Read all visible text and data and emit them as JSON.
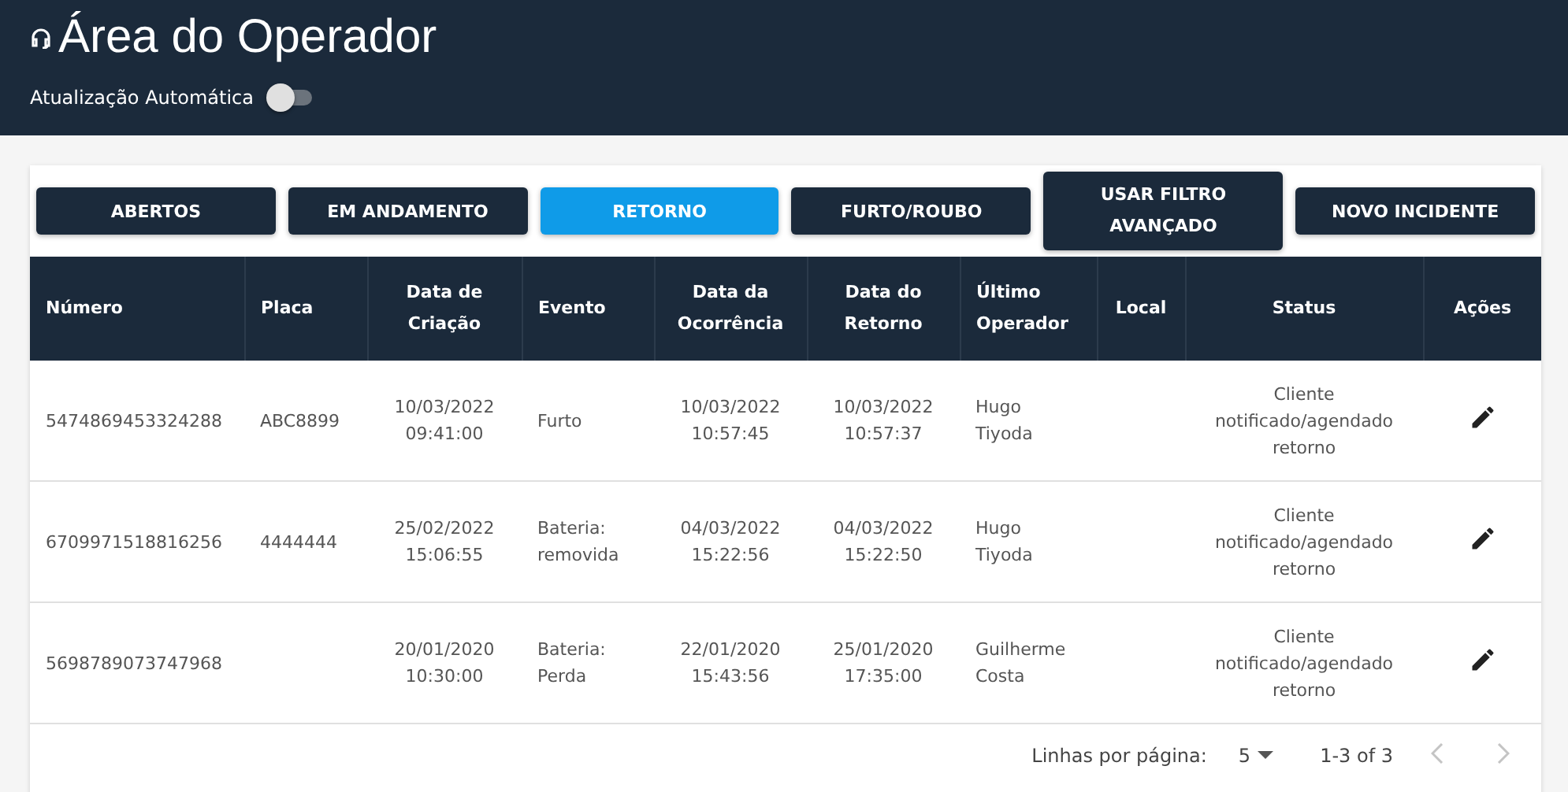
{
  "header": {
    "title": "Área do Operador",
    "auto_refresh": {
      "label": "Atualização Automática",
      "on": false
    }
  },
  "tabs": [
    {
      "label": "ABERTOS",
      "selected": false
    },
    {
      "label": "EM ANDAMENTO",
      "selected": false
    },
    {
      "label": "RETORNO",
      "selected": true
    },
    {
      "label": "FURTO/ROUBO",
      "selected": false
    },
    {
      "label": "USAR FILTRO AVANÇADO",
      "selected": false
    },
    {
      "label": "NOVO INCIDENTE",
      "selected": false
    }
  ],
  "table": {
    "columns": [
      "Número",
      "Placa",
      "Data de Criação",
      "Evento",
      "Data da Ocorrência",
      "Data do Retorno",
      "Último Operador",
      "Local",
      "Status",
      "Ações"
    ],
    "rows": [
      {
        "cells": [
          "5474869453324288",
          "ABC8899",
          "10/03/2022 09:41:00",
          "Furto",
          "10/03/2022 10:57:45",
          "10/03/2022 10:57:37",
          "Hugo Tiyoda",
          "",
          "Cliente notificado/agendado retorno"
        ]
      },
      {
        "cells": [
          "6709971518816256",
          "4444444",
          "25/02/2022 15:06:55",
          "Bateria: removida",
          "04/03/2022 15:22:56",
          "04/03/2022 15:22:50",
          "Hugo Tiyoda",
          "",
          "Cliente notificado/agendado retorno"
        ]
      },
      {
        "cells": [
          "5698789073747968",
          "",
          "20/01/2020 10:30:00",
          "Bateria: Perda",
          "22/01/2020 15:43:56",
          "25/01/2020 17:35:00",
          "Guilherme Costa",
          "",
          "Cliente notificado/agendado retorno"
        ]
      }
    ]
  },
  "pagination": {
    "rows_label": "Linhas por página:",
    "rows_value": "5",
    "range": "1-3 of 3",
    "prev_disabled": true,
    "next_disabled": true
  }
}
